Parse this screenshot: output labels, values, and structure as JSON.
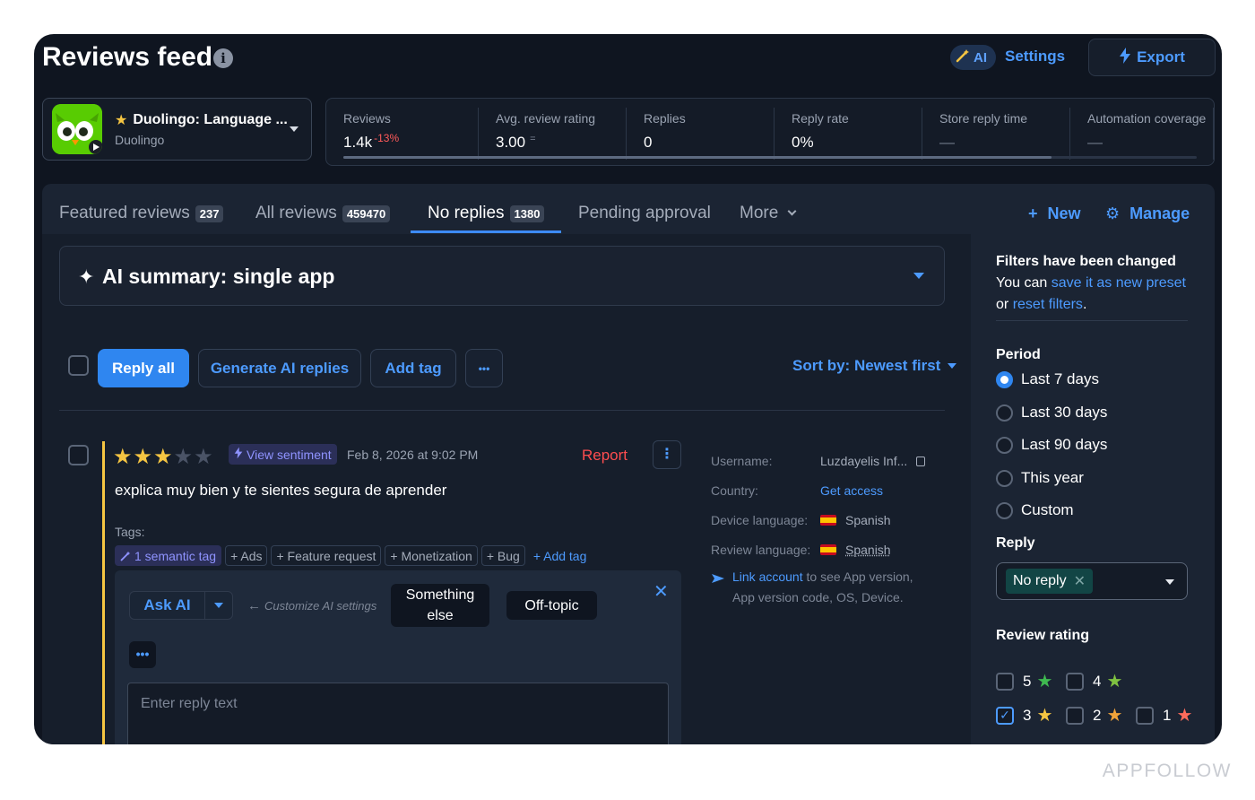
{
  "header": {
    "title": "Reviews feed",
    "ai_badge": "AI",
    "settings_label": "Settings",
    "export_label": "Export"
  },
  "app": {
    "name": "Duolingo: Language ...",
    "developer": "Duolingo"
  },
  "stats": [
    {
      "label": "Reviews",
      "value": "1.4k",
      "delta": "-13%"
    },
    {
      "label": "Avg. review rating",
      "value": "3.00",
      "delta": "="
    },
    {
      "label": "Replies",
      "value": "0"
    },
    {
      "label": "Reply rate",
      "value": "0%"
    },
    {
      "label": "Store reply time",
      "value": "—"
    },
    {
      "label": "Automation coverage",
      "value": "—"
    }
  ],
  "tabs": [
    {
      "label": "Featured reviews",
      "count": "237"
    },
    {
      "label": "All reviews",
      "count": "459470"
    },
    {
      "label": "No replies",
      "count": "1380"
    },
    {
      "label": "Pending approval"
    },
    {
      "label": "More"
    }
  ],
  "tab_actions": {
    "new_label": "New",
    "manage_label": "Manage"
  },
  "summary": {
    "title": "AI summary: single app"
  },
  "toolbar": {
    "reply_all": "Reply all",
    "generate_ai": "Generate AI replies",
    "add_tag": "Add tag",
    "more": "•••",
    "sort_label": "Sort by: Newest first"
  },
  "review": {
    "rating": 3,
    "sentiment_label": "View sentiment",
    "date": "Feb 8, 2026 at 9:02 PM",
    "report_label": "Report",
    "text": "explica muy bien y te sientes segura de aprender",
    "tags_label": "Tags:",
    "tags": [
      "1 semantic tag",
      "+ Ads",
      "+ Feature request",
      "+ Monetization",
      "+ Bug",
      "+ Add tag"
    ],
    "reply": {
      "ask_ai": "Ask AI",
      "customize": "Customize AI settings",
      "chip1": "Something else",
      "chip2": "Off-topic",
      "dots": "•••",
      "placeholder": "Enter reply text"
    },
    "meta": {
      "username_label": "Username:",
      "username_value": "Luzdayelis Inf...",
      "country_label": "Country:",
      "country_value": "Get access",
      "device_lang_label": "Device language:",
      "device_lang_value": "Spanish",
      "review_lang_label": "Review language:",
      "review_lang_value": "Spanish",
      "link_account": "Link account",
      "link_account_suffix": "to see App version, App version code, OS, Device."
    }
  },
  "filters": {
    "title": "Filters have been changed",
    "line2_prefix": "You can",
    "save_link": "save it as new preset",
    "line3_prefix": "or",
    "reset_link": "reset filters",
    "period_title": "Period",
    "period_options": [
      "Last 7 days",
      "Last 30 days",
      "Last 90 days",
      "This year",
      "Custom"
    ],
    "period_selected": "Last 7 days",
    "reply_title": "Reply",
    "reply_value": "No reply",
    "rating_title": "Review rating",
    "ratings": [
      {
        "label": "5",
        "checked": false,
        "color": "#3fb950"
      },
      {
        "label": "4",
        "checked": false,
        "color": "#7fc241"
      },
      {
        "label": "3",
        "checked": true,
        "color": "#f5c542"
      },
      {
        "label": "2",
        "checked": false,
        "color": "#f0a33a"
      },
      {
        "label": "1",
        "checked": false,
        "color": "#ff6b5b"
      }
    ]
  },
  "watermark": "APPFOLLOW",
  "colors": {
    "accent": "#2f86f0",
    "link": "#4d9bff",
    "danger": "#ff4d4f",
    "star": "#f5c542"
  }
}
